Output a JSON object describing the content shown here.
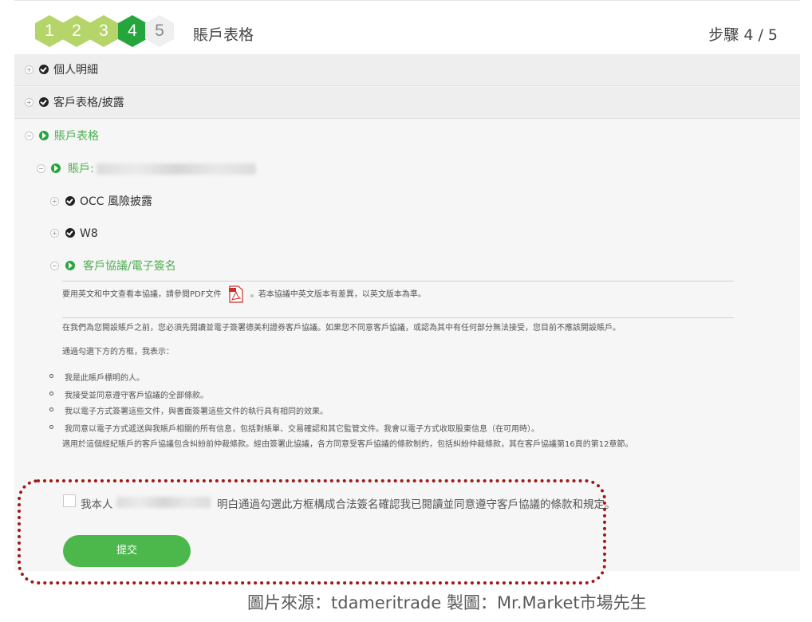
{
  "steps": [
    "1",
    "2",
    "3",
    "4",
    "5"
  ],
  "current_step": 4,
  "header": {
    "title": "賬戶表格",
    "step_counter": "步驟 4 / 5"
  },
  "sections": {
    "personal": "個人明細",
    "customer_forms": "客戶表格/披露",
    "account_forms": "賬戶表格",
    "account_prefix": "賬戶:",
    "occ": "OCC 風險披露",
    "w8": "W8",
    "agreement": "客戶協議/電子簽名"
  },
  "agreement": {
    "pdf_before": "要用英文和中文查看本協議，請參閱PDF文件",
    "pdf_after": "。若本協議中英文版本有差異，以英文版本為準。",
    "pdf_icon": "pdf-file-icon",
    "para2": "在我們為您開設賬戶之前，您必須先閱讀並電子簽署德美利證券客戶協議。如果您不同意客戶協議，或認為其中有任何部分無法接受，您目前不應該開設賬戶。",
    "para3": "通過勾選下方的方框，我表示：",
    "bullets": [
      "我是此賬戶標明的人。",
      "我接受並同意遵守客戶協議的全部條款。",
      "我以電子方式簽署這些文件，與書面簽署這些文件的執行具有相同的效果。",
      "我同意以電子方式遞送與我賬戶相關的所有信息，包括對賬單、交易確認和其它監管文件。我會以電子方式收取股東信息（在可用時）。"
    ],
    "bullet_cont": "適用於這個經紀賬戶的客戶協議包含糾紛前仲裁條款。經由簽署此協議，各方同意受客戶協議的條款制約，包括糾紛仲裁條款，其在客戶協議第16頁的第12章節。"
  },
  "signature": {
    "prefix": "我本人",
    "suffix": "明白通過勾選此方框構成合法簽名確認我已閱讀並同意遵守客戶協議的條款和規定。",
    "submit": "提交"
  },
  "caption": "圖片來源：tdameritrade  製圖：Mr.Market市場先生",
  "colors": {
    "green": "#27a53d",
    "light_green": "#b5d56a",
    "button": "#4cb84c",
    "highlight_border": "#a01818"
  }
}
